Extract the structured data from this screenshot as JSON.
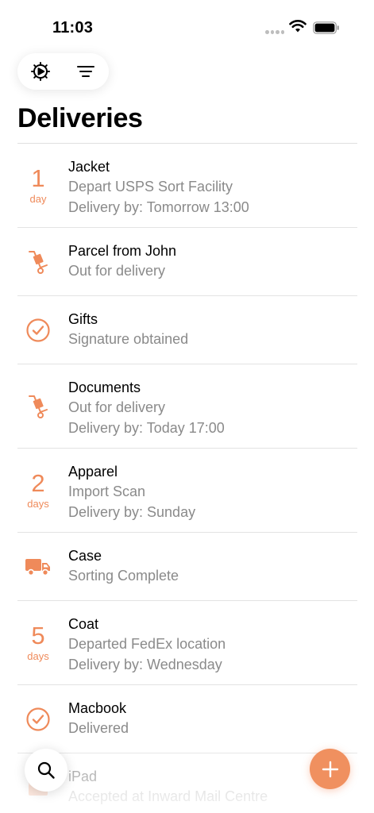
{
  "status": {
    "time": "11:03"
  },
  "header": {
    "title": "Deliveries"
  },
  "toolbar": {
    "settings_icon": "gear-icon",
    "filter_icon": "filter-lines-icon"
  },
  "colors": {
    "accent": "#f0905f",
    "secondary_text": "#8a8a8a"
  },
  "deliveries": [
    {
      "title": "Jacket",
      "status": "Depart USPS Sort Facility",
      "eta": "Delivery by: Tomorrow 13:00",
      "lead": {
        "kind": "days",
        "number": "1",
        "unit": "day"
      }
    },
    {
      "title": "Parcel from John",
      "status": "Out for delivery",
      "lead": {
        "kind": "icon",
        "icon": "hand-truck-icon"
      }
    },
    {
      "title": "Gifts",
      "status": "Signature obtained",
      "lead": {
        "kind": "icon",
        "icon": "checkmark-circle-icon"
      }
    },
    {
      "title": "Documents",
      "status": "Out for delivery",
      "eta": "Delivery by: Today 17:00",
      "lead": {
        "kind": "icon",
        "icon": "hand-truck-icon"
      }
    },
    {
      "title": "Apparel",
      "status": "Import Scan",
      "eta": "Delivery by: Sunday",
      "lead": {
        "kind": "days",
        "number": "2",
        "unit": "days"
      }
    },
    {
      "title": "Case",
      "status": "Sorting Complete",
      "lead": {
        "kind": "icon",
        "icon": "truck-icon"
      }
    },
    {
      "title": "Coat",
      "status": "Departed FedEx location",
      "eta": "Delivery by: Wednesday",
      "lead": {
        "kind": "days",
        "number": "5",
        "unit": "days"
      }
    },
    {
      "title": "Macbook",
      "status": "Delivered",
      "lead": {
        "kind": "icon",
        "icon": "checkmark-circle-icon"
      }
    },
    {
      "title": "iPad",
      "status": "Accepted at Inward Mail Centre",
      "lead": {
        "kind": "icon",
        "icon": "box-icon"
      }
    }
  ],
  "fabs": {
    "search_icon": "search-icon",
    "add_icon": "plus-icon"
  }
}
